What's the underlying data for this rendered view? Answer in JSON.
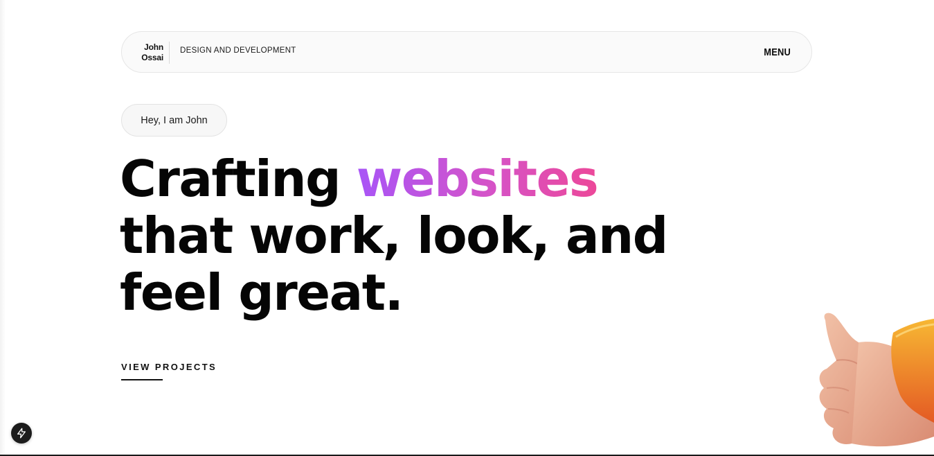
{
  "header": {
    "brand_first": "John",
    "brand_last": "Ossai",
    "tagline": "DESIGN AND DEVELOPMENT",
    "menu_label": "MENU"
  },
  "hero": {
    "greeting": "Hey, I am John",
    "headline_word1": "Crafting",
    "headline_highlight": "websites",
    "headline_line2": "that work, look, and",
    "headline_line3": "feel great.",
    "cta": "VIEW PROJECTS"
  },
  "colors": {
    "gradient_start": "#a855f7",
    "gradient_end": "#ec4899",
    "text": "#050505",
    "background": "#ffffff"
  },
  "icons": {
    "badge": "lightning-bolt-icon",
    "illustration": "thumbs-up-hand-icon"
  }
}
